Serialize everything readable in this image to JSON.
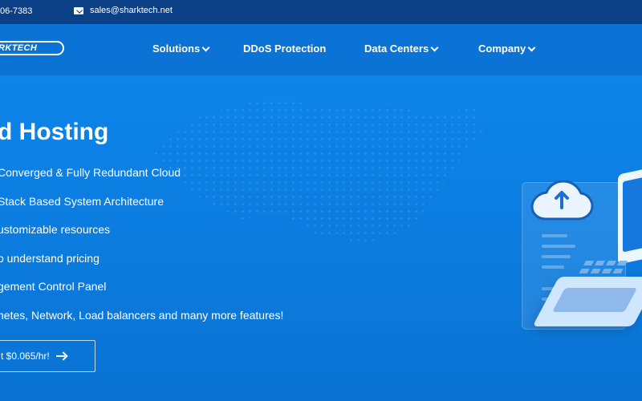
{
  "topbar": {
    "phone": "06-7383",
    "email": "sales@sharktech.net",
    "icons": {
      "mail": "mail-icon"
    }
  },
  "brand": {
    "logo_text": "RKTECH"
  },
  "nav": {
    "items": [
      {
        "label": "Solutions",
        "dropdown": true
      },
      {
        "label": "DDoS Protection",
        "dropdown": false
      },
      {
        "label": "Data Centers",
        "dropdown": true
      },
      {
        "label": "Company",
        "dropdown": true
      }
    ]
  },
  "hero": {
    "headline": "d Hosting",
    "features": [
      "Converged & Fully Redundant Cloud",
      "Stack Based System Architecture",
      "ustomizable resources",
      "o understand pricing",
      "gement Control Panel",
      "netes, Network, Load balancers and many more features!"
    ],
    "cta": {
      "label": "t $0.065/hr!",
      "icon": "arrow-right-icon"
    }
  },
  "colors": {
    "topbar": "#0b3f86",
    "nav": "#0b72d6",
    "hero": "#0d85ea",
    "text": "#ffffff"
  }
}
